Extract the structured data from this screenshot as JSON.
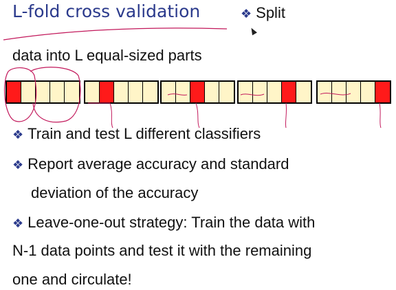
{
  "title": "L-fold cross validation",
  "title_tail": "Split",
  "line_data": "data into L equal-sized parts",
  "folds": [
    {
      "test_index": 0
    },
    {
      "test_index": 1
    },
    {
      "test_index": 2
    },
    {
      "test_index": 3
    },
    {
      "test_index": 4
    }
  ],
  "bullets": {
    "b1": "Train and test L different classifiers",
    "b2a": "Report average accuracy and standard",
    "b2b": "deviation of the accuracy",
    "b3a": "Leave-one-out strategy: Train the data with",
    "b3b": "N-1 data points and test it with the remaining",
    "b3c": "one and circulate!"
  },
  "bullet_symbol": "❖",
  "colors": {
    "title": "#2b3a8c",
    "test_cell": "#ff1a1a",
    "train_cell": "#fff5c8",
    "ink": "#c2185b"
  }
}
